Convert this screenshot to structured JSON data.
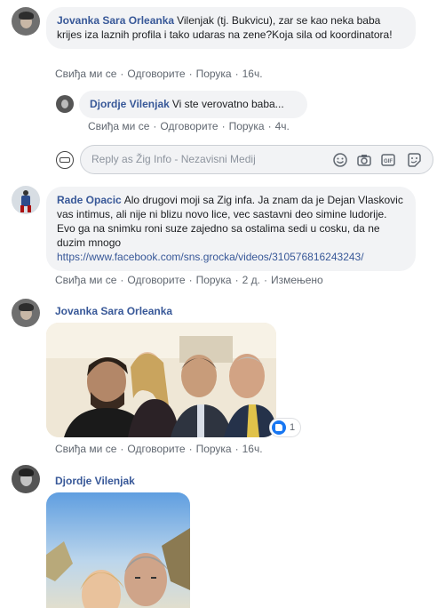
{
  "comments": [
    {
      "author": "Jovanka Sara Orleanka",
      "text": "Vilenjak (tj. Bukvicu), zar se kao neka baba krijes iza laznih profila i tako udaras na zene?Koja sila od koordinatora!",
      "actions": [
        "Свиђа ми се",
        "Одговорите",
        "Порука",
        "16ч."
      ]
    },
    {
      "author": "Djordje Vilenjak",
      "text": "Vi ste verovatno baba...",
      "actions": [
        "Свиђа ми се",
        "Одговорите",
        "Порука",
        "4ч."
      ]
    },
    {
      "author": "Rade Opacic",
      "text": "Alo drugovi moji sa Zig infa. Ja znam da je Dejan Vlaskovic vas intimus, ali nije ni blizu novo lice, vec sastavni deo simine ludorije. Evo ga na snimku roni suze zajedno sa ostalima sedi u cosku, da ne duzim mnogo",
      "link": "https://www.facebook.com/sns.grocka/videos/310576816243243/",
      "actions": [
        "Свиђа ми се",
        "Одговорите",
        "Порука",
        "2 д.",
        "Измењено"
      ]
    },
    {
      "author": "Jovanka Sara Orleanka",
      "reactions": "1",
      "actions": [
        "Свиђа ми се",
        "Одговорите",
        "Порука",
        "16ч."
      ]
    },
    {
      "author": "Djordje Vilenjak"
    }
  ],
  "reply_box": {
    "placeholder": "Reply as Žig Info - Nezavisni Medij",
    "icons": [
      "emoji-icon",
      "camera-icon",
      "gif-icon",
      "sticker-icon"
    ]
  },
  "colors": {
    "link": "#385898",
    "bubble": "#f2f3f5",
    "meta": "#606770",
    "like": "#1877f2"
  }
}
